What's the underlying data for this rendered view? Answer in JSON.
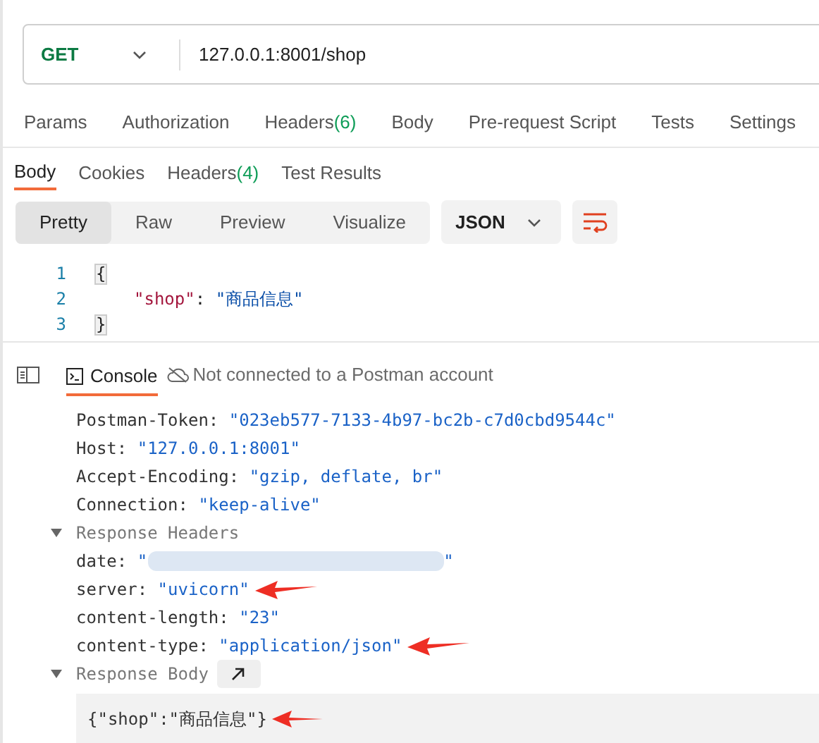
{
  "request": {
    "method": "GET",
    "url": "127.0.0.1:8001/shop"
  },
  "request_tabs": [
    {
      "label": "Params",
      "selected": false
    },
    {
      "label": "Authorization",
      "selected": false
    },
    {
      "label": "Headers",
      "count": "(6)",
      "selected": false
    },
    {
      "label": "Body",
      "selected": false
    },
    {
      "label": "Pre-request Script",
      "selected": false
    },
    {
      "label": "Tests",
      "selected": false
    },
    {
      "label": "Settings",
      "selected": false
    }
  ],
  "response_tabs": [
    {
      "label": "Body",
      "selected": true
    },
    {
      "label": "Cookies",
      "selected": false
    },
    {
      "label": "Headers",
      "count": "(4)",
      "selected": false
    },
    {
      "label": "Test Results",
      "selected": false
    }
  ],
  "view_modes": [
    {
      "label": "Pretty",
      "selected": true
    },
    {
      "label": "Raw",
      "selected": false
    },
    {
      "label": "Preview",
      "selected": false
    },
    {
      "label": "Visualize",
      "selected": false
    }
  ],
  "format": "JSON",
  "code_lines": [
    {
      "number": "1",
      "text": "{",
      "kind": "brace"
    },
    {
      "number": "2",
      "key": "\"shop\"",
      "sep": ": ",
      "value": "\"商品信息\"",
      "kind": "pair"
    },
    {
      "number": "3",
      "text": "}",
      "kind": "brace"
    }
  ],
  "console": {
    "tab": "Console",
    "status": "Not connected to a Postman account",
    "request_headers": [
      {
        "key": "Postman-Token: ",
        "value": "\"023eb577-7133-4b97-bc2b-c7d0cbd9544c\""
      },
      {
        "key": "Host: ",
        "value": "\"127.0.0.1:8001\""
      },
      {
        "key": "Accept-Encoding: ",
        "value": "\"gzip, deflate, br\""
      },
      {
        "key": "Connection: ",
        "value": "\"keep-alive\""
      }
    ],
    "response_headers": {
      "title": "Response Headers",
      "expanded": true,
      "items": [
        {
          "key": "date: ",
          "value_start": "\"",
          "value_end": "\"",
          "redacted": true,
          "annotated": false
        },
        {
          "key": "server: ",
          "value": "\"uvicorn\"",
          "annotated": true
        },
        {
          "key": "content-length: ",
          "value": "\"23\"",
          "annotated": false
        },
        {
          "key": "content-type: ",
          "value": "\"application/json\"",
          "annotated": true
        }
      ]
    },
    "response_body": {
      "title": "Response Body",
      "expanded": true,
      "text": "{\"shop\":\"商品信息\"}",
      "annotated": true
    }
  }
}
